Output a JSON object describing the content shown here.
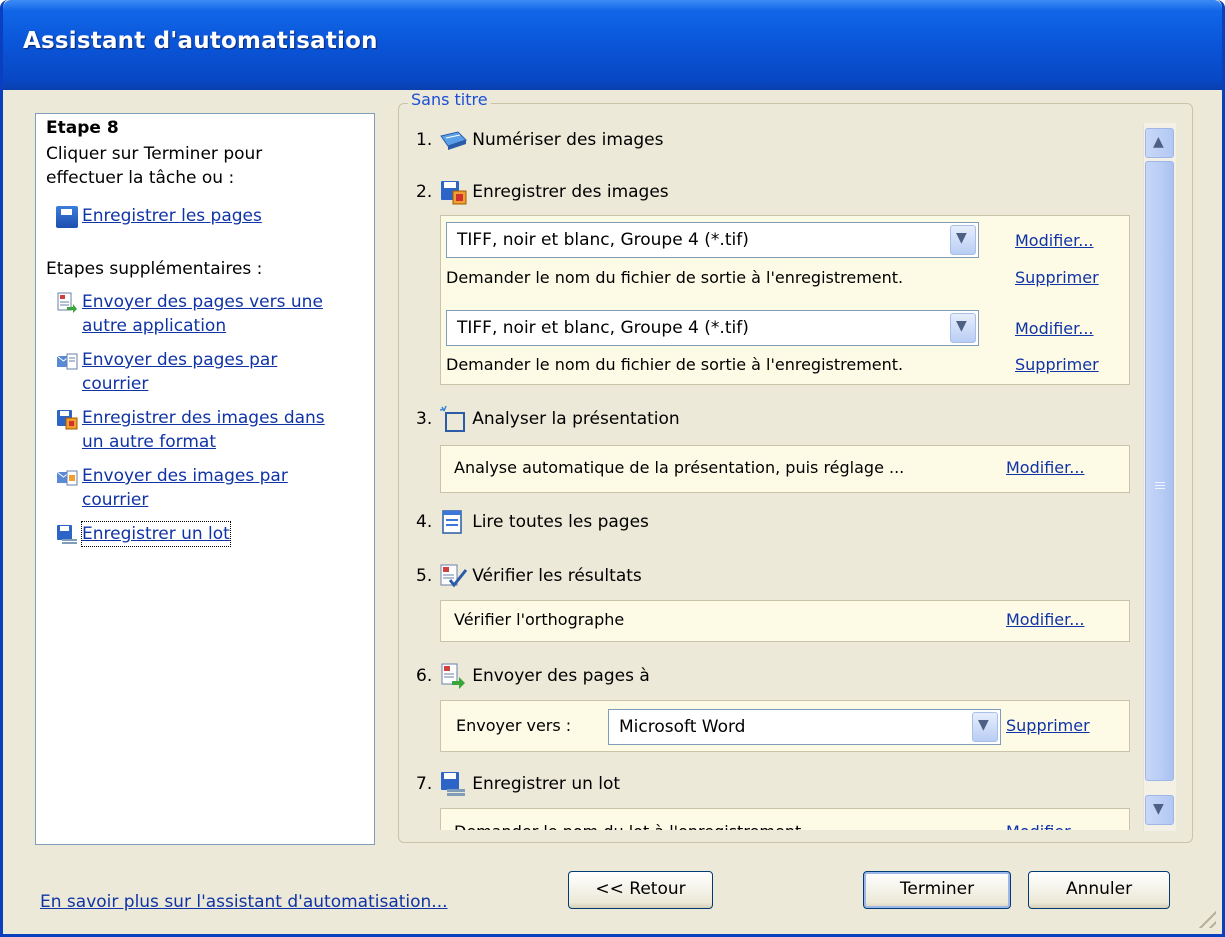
{
  "window": {
    "title": "Assistant d'automatisation"
  },
  "left": {
    "step_title": "Etape 8",
    "step_text1": "Cliquer sur Terminer pour",
    "step_text2": "effectuer la tâche ou :",
    "save_pages": "Enregistrer les pages",
    "extra_title": "Etapes supplémentaires :",
    "extra": [
      {
        "l1": "Envoyer des pages vers une",
        "l2": "autre application"
      },
      {
        "l1": "Envoyer des pages par",
        "l2": "courrier"
      },
      {
        "l1": "Enregistrer des images dans",
        "l2": "un autre format"
      },
      {
        "l1": "Envoyer des images par",
        "l2": "courrier"
      },
      {
        "l1": "Enregistrer un lot",
        "l2": ""
      }
    ]
  },
  "group": {
    "label": "Sans titre"
  },
  "steps": {
    "s1": {
      "num": "1.",
      "label": "Numériser des images"
    },
    "s2": {
      "num": "2.",
      "label": "Enregistrer des images",
      "formats": [
        {
          "value": "TIFF, noir et blanc, Groupe 4 (*.tif)",
          "desc": "Demander le nom du fichier de sortie à l'enregistrement.",
          "modify": "Modifier...",
          "delete": "Supprimer"
        },
        {
          "value": "TIFF, noir et blanc, Groupe 4 (*.tif)",
          "desc": "Demander le nom du fichier de sortie à l'enregistrement.",
          "modify": "Modifier...",
          "delete": "Supprimer"
        }
      ]
    },
    "s3": {
      "num": "3.",
      "label": "Analyser la présentation",
      "desc": "Analyse automatique de la présentation, puis réglage ...",
      "modify": "Modifier..."
    },
    "s4": {
      "num": "4.",
      "label": "Lire toutes les pages"
    },
    "s5": {
      "num": "5.",
      "label": "Vérifier les résultats",
      "desc": "Vérifier l'orthographe",
      "modify": "Modifier..."
    },
    "s6": {
      "num": "6.",
      "label": "Envoyer des pages à",
      "send_label": "Envoyer vers :",
      "send_value": "Microsoft Word",
      "delete": "Supprimer"
    },
    "s7": {
      "num": "7.",
      "label": "Enregistrer un lot",
      "desc_partial": "Demander le nom du lot à l'enregistrement",
      "modify_partial": "Modifier..."
    }
  },
  "footer": {
    "learn_more": "En savoir plus sur l'assistant d'automatisation...",
    "back": "<< Retour",
    "finish": "Terminer",
    "cancel": "Annuler"
  },
  "colors": {
    "title_bar": "#0a55d8",
    "link": "#1033a6",
    "panel_bg": "#ece9d8",
    "highlight_box": "#fdfbe6"
  }
}
